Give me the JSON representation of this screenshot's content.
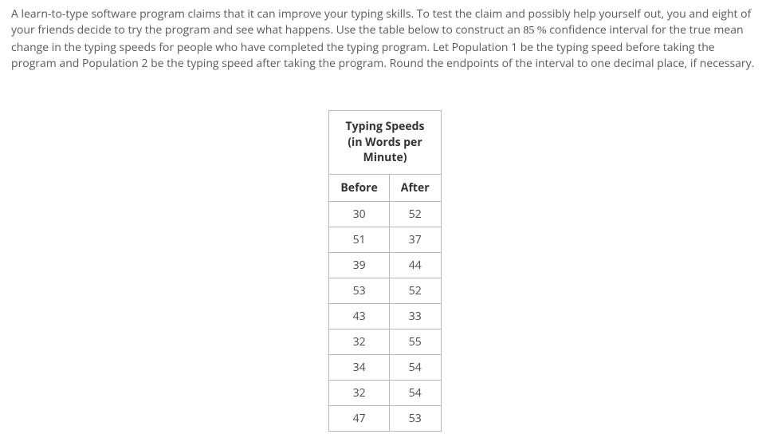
{
  "problem": {
    "text_before_pct": "A learn-to-type software program claims that it can improve your typing skills. To test the claim and possibly help yourself out, you and eight of your friends decide to try the program and see what happens. Use the table below to construct an ",
    "pct_value": "85 %",
    "text_after_pct": " confidence interval for the true mean change in the typing speeds for people who have completed the typing program. Let Population 1 be the typing speed before taking the program and Population 2 be the typing speed after taking the program. Round the endpoints of the interval to one decimal place, if necessary."
  },
  "table": {
    "title": "Typing Speeds (in Words per Minute)",
    "headers": {
      "before": "Before",
      "after": "After"
    },
    "rows": [
      {
        "before": "30",
        "after": "52"
      },
      {
        "before": "51",
        "after": "37"
      },
      {
        "before": "39",
        "after": "44"
      },
      {
        "before": "53",
        "after": "52"
      },
      {
        "before": "43",
        "after": "33"
      },
      {
        "before": "32",
        "after": "55"
      },
      {
        "before": "34",
        "after": "54"
      },
      {
        "before": "32",
        "after": "54"
      },
      {
        "before": "47",
        "after": "53"
      }
    ]
  },
  "chart_data": {
    "type": "table",
    "title": "Typing Speeds (in Words per Minute)",
    "columns": [
      "Before",
      "After"
    ],
    "rows": [
      [
        30,
        52
      ],
      [
        51,
        37
      ],
      [
        39,
        44
      ],
      [
        53,
        52
      ],
      [
        43,
        33
      ],
      [
        32,
        55
      ],
      [
        34,
        54
      ],
      [
        32,
        54
      ],
      [
        47,
        53
      ]
    ]
  }
}
